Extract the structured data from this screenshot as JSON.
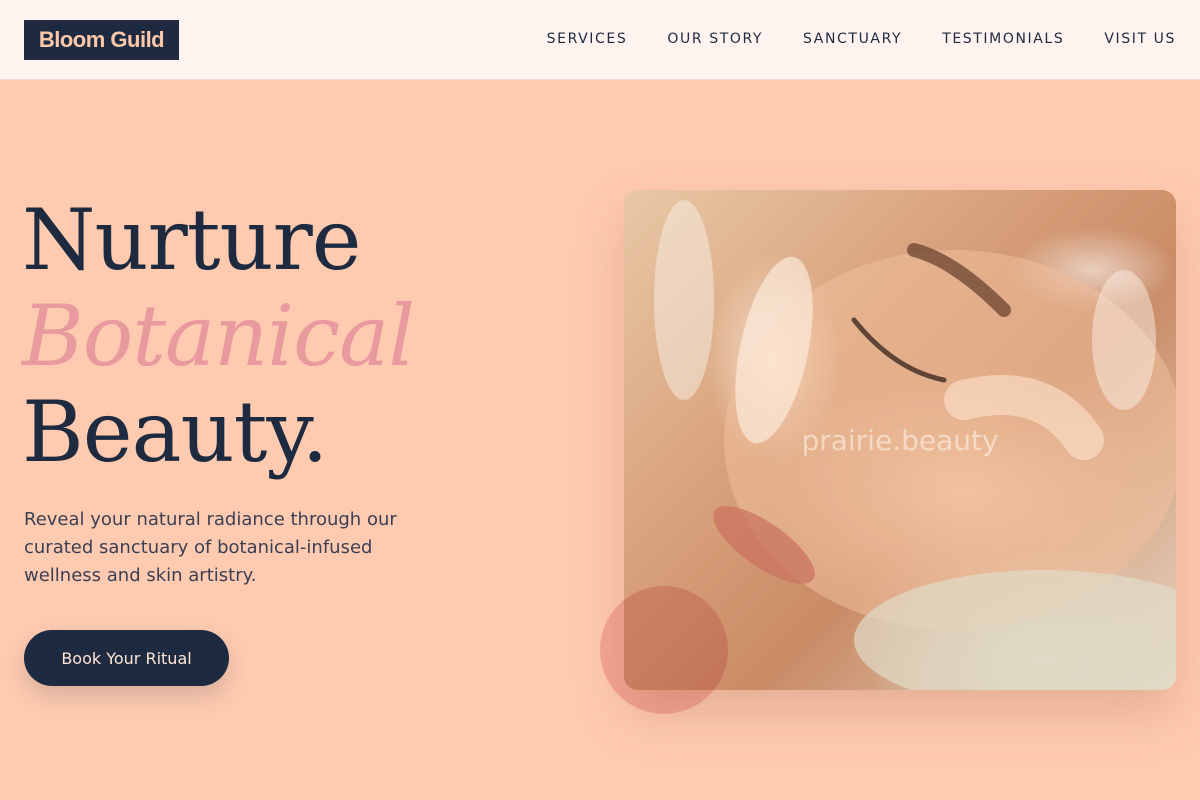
{
  "brand": {
    "logo_text": "Bloom Guild"
  },
  "nav": {
    "items": [
      {
        "label": "SERVICES"
      },
      {
        "label": "OUR STORY"
      },
      {
        "label": "SANCTUARY"
      },
      {
        "label": "TESTIMONIALS"
      },
      {
        "label": "VISIT US"
      }
    ]
  },
  "hero": {
    "title_line1": "Nurture",
    "title_line2": "Botanical",
    "title_line3": "Beauty.",
    "subtitle": "Reveal your natural radiance through our curated sanctuary of botanical-infused wellness and skin artistry.",
    "cta_label": "Book Your Ritual",
    "image_watermark": "prairie.beauty"
  },
  "colors": {
    "background": "#FFCBB0",
    "header_bg": "#FFF3EF",
    "navy": "#1E2A40",
    "accent_pink": "#E89A9E"
  }
}
